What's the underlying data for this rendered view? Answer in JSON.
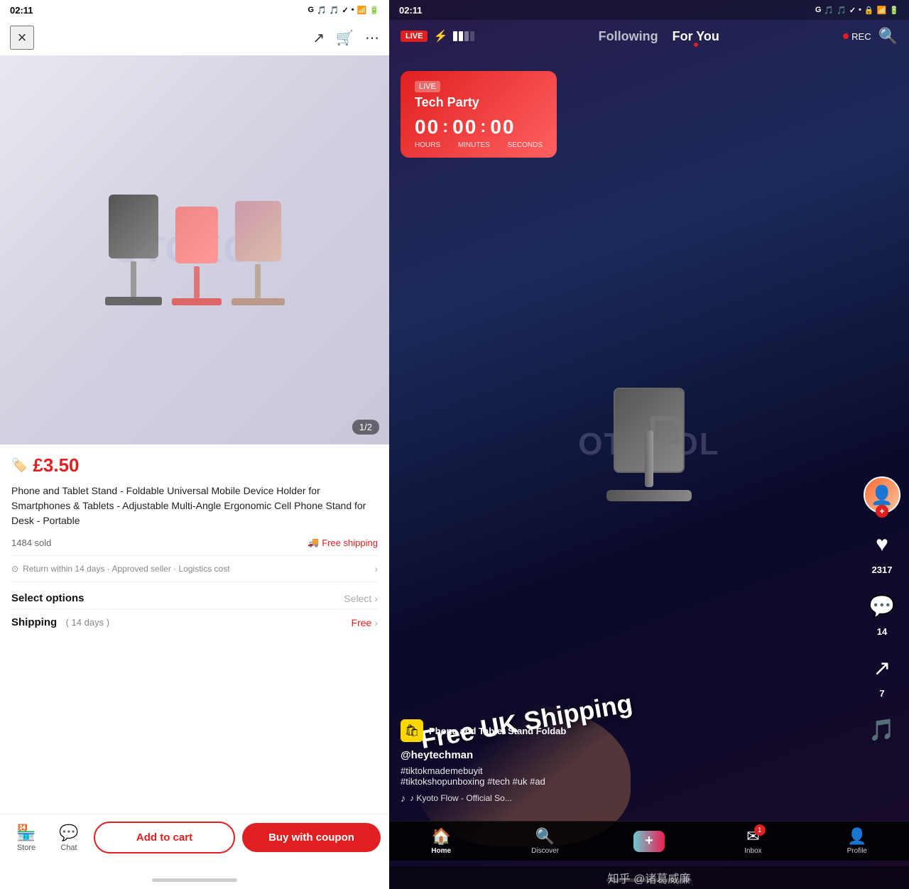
{
  "left": {
    "status": {
      "time": "02:11",
      "icons": "G 🎵 🎵 ✓ •"
    },
    "nav": {
      "close_label": "×",
      "share_label": "↗",
      "cart_label": "🛒",
      "more_label": "⋯"
    },
    "image_counter": "1/2",
    "watermark": "OTOKOL",
    "price": "£3.50",
    "price_icon": "🏷️",
    "title": "Phone and Tablet Stand - Foldable Universal Mobile Device Holder for Smartphones & Tablets - Adjustable Multi-Angle Ergonomic Cell Phone Stand for Desk - Portable",
    "sold": "1484 sold",
    "free_shipping": "Free shipping",
    "returns": "Return within 14 days · Approved seller · Logistics cost",
    "select_options_label": "Select options",
    "select_btn": "Select",
    "shipping_label": "Shipping",
    "shipping_days": "( 14 days )",
    "shipping_free": "Free",
    "add_to_cart": "Add to cart",
    "buy_with_coupon": "Buy with coupon",
    "store_label": "Store",
    "chat_label": "Chat"
  },
  "right": {
    "status": {
      "time": "02:11",
      "icons": "G 🎵 🎵 ✓ •"
    },
    "nav": {
      "live_badge": "LIVE",
      "following_tab": "Following",
      "for_you_tab": "For You",
      "rec_label": "REC",
      "search_icon": "🔍"
    },
    "tech_party": {
      "live_badge": "LIVE",
      "title": "Tech Party",
      "hours": "00",
      "minutes": "00",
      "seconds": "00",
      "hours_label": "HOURS",
      "minutes_label": "MINUTES",
      "seconds_label": "SECONDS"
    },
    "watermark": "OTOKOL",
    "free_shipping_overlay": "Free UK Shipping",
    "shop_name": "Phone and Tablet Stand  Foldab",
    "username": "@heytechman",
    "hashtags": "#tiktokmademebuyit\n#tiktokshopunboxing #tech #uk #ad",
    "music": "♪  Kyoto Flow - Official So...",
    "likes": "2317",
    "comments": "14",
    "shares": "7",
    "bottom_nav": {
      "home": "Home",
      "discover": "Discover",
      "plus": "+",
      "inbox": "Inbox",
      "profile": "Profile"
    },
    "inbox_badge": "1",
    "zhihu_watermark": "知乎 @诸葛威廉"
  }
}
